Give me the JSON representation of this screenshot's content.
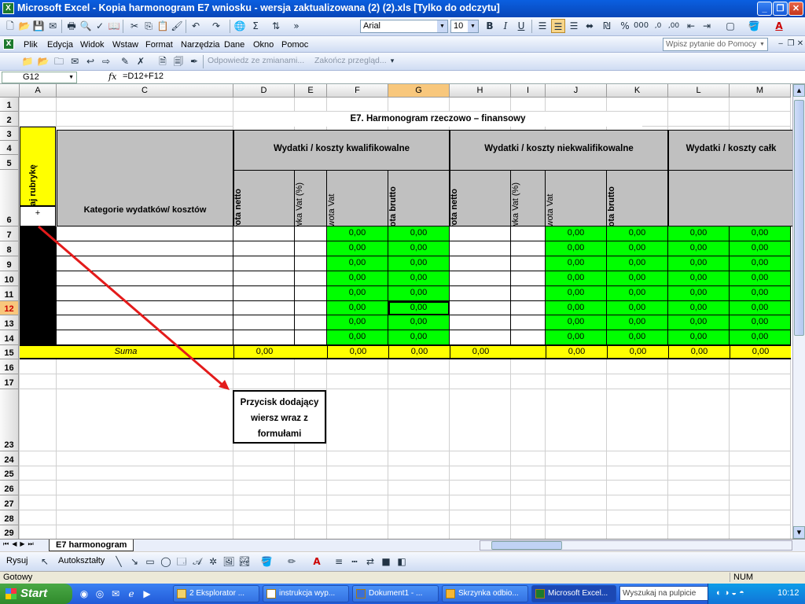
{
  "window": {
    "title": "Microsoft Excel - Kopia harmonogram E7 wniosku - wersja zaktualizowana (2) (2).xls  [Tylko do odczytu]"
  },
  "toolbar": {
    "font": "Arial",
    "size": "10"
  },
  "menu": {
    "items": [
      "Plik",
      "Edycja",
      "Widok",
      "Wstaw",
      "Format",
      "Narzędzia",
      "Dane",
      "Okno",
      "Pomoc"
    ],
    "help_placeholder": "Wpisz pytanie do Pomocy"
  },
  "review_bar": {
    "reply": "Odpowiedz ze zmianami...",
    "end_review": "Zakończ przegląd..."
  },
  "formula_bar": {
    "name_box": "G12",
    "fx": "fx",
    "formula": "=D12+F12"
  },
  "columns": [
    "A",
    "C",
    "D",
    "E",
    "F",
    "G",
    "H",
    "I",
    "J",
    "K",
    "L",
    "M"
  ],
  "rows": [
    "1",
    "2",
    "3",
    "4",
    "5",
    "6",
    "7",
    "8",
    "9",
    "10",
    "11",
    "12",
    "13",
    "14",
    "15",
    "16",
    "17",
    "23",
    "24",
    "25",
    "26",
    "27",
    "28",
    "29"
  ],
  "sheet": {
    "title": "E7. Harmonogram rzeczowo – finansowy",
    "add_row": "dodaj rubrykę",
    "plus": "+",
    "category_header": "Kategorie wydatków/ kosztów",
    "group1": "Wydatki / koszty kwalifikowalne",
    "group2": "Wydatki / koszty niekwalifikowalne",
    "group3": "Wydatki / koszty całk",
    "sub_netto": "kwota netto",
    "sub_rate": "Stawka Vat (%)",
    "sub_vat": "kwota Vat",
    "sub_brutto": "kwota brutto",
    "zero": "0,00",
    "suma": "Suma",
    "callout": "Przycisk dodający wiersz wraz z formułami"
  },
  "sheet_tab": "E7 harmonogram",
  "drawing": {
    "draw": "Rysuj",
    "autoshapes": "Autokształty"
  },
  "status": {
    "left": "Gotowy",
    "num": "NUM"
  },
  "taskbar": {
    "start": "Start",
    "tasks": [
      "2 Eksplorator ...",
      "instrukcja wyp...",
      "Dokument1 - ...",
      "Skrzynka odbio...",
      "Microsoft Excel..."
    ],
    "search": "Wyszukaj na pulpicie",
    "time": "10:12"
  }
}
